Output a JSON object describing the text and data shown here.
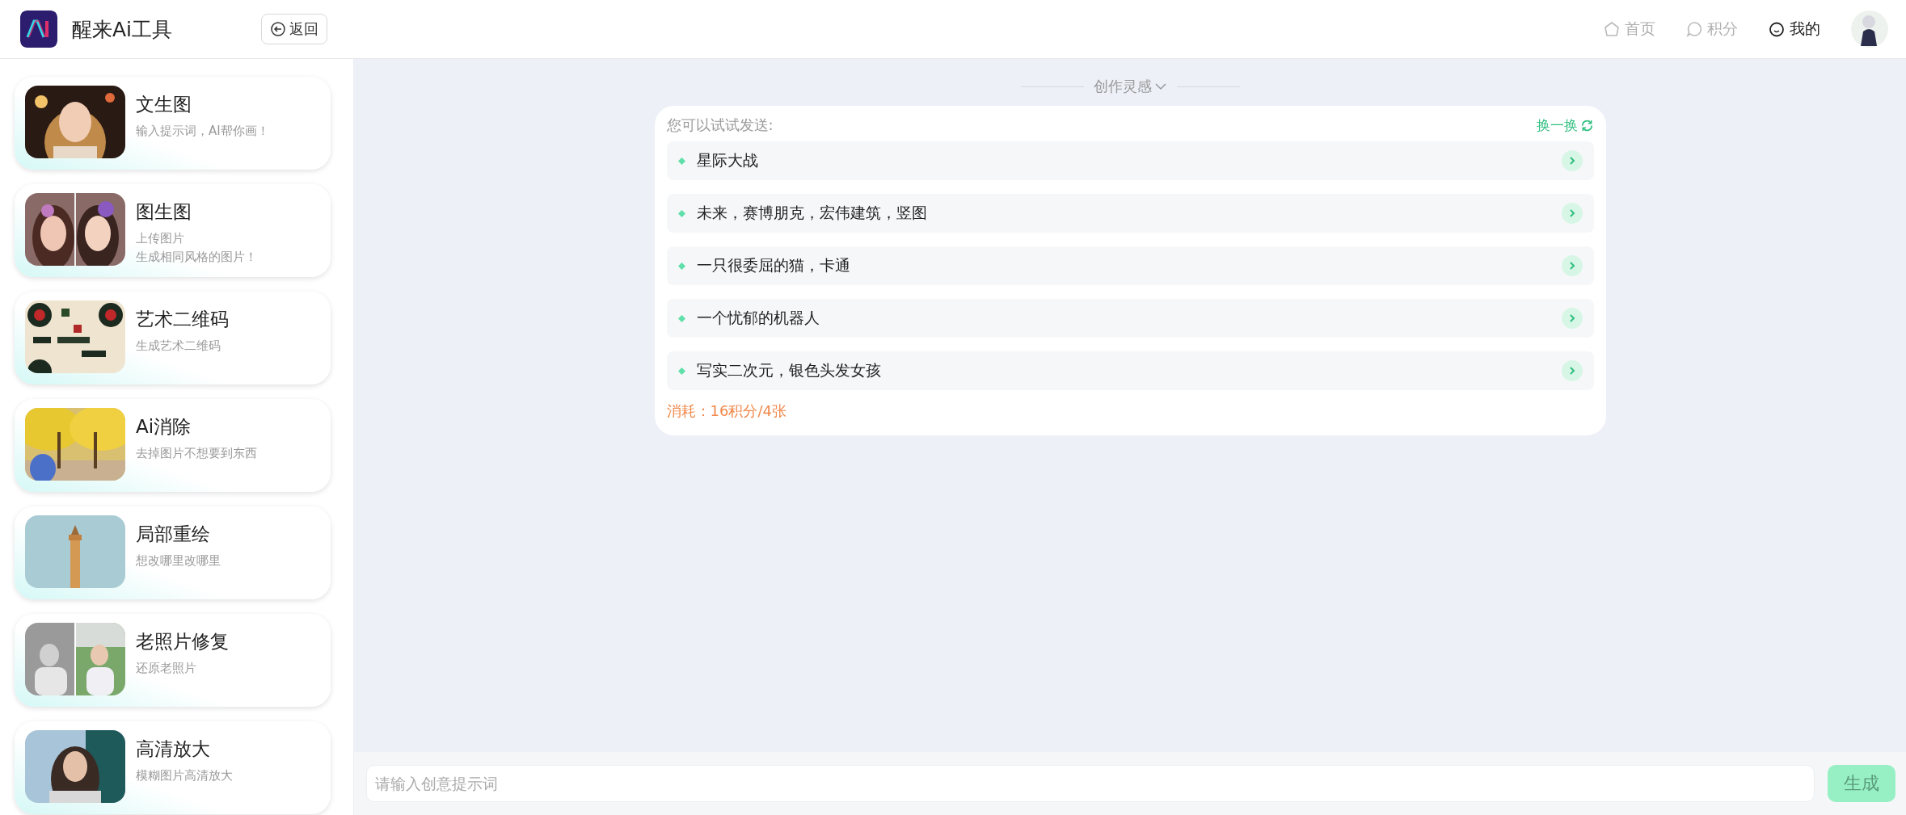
{
  "header": {
    "app_name": "醒来Ai工具",
    "back_button": "返回",
    "nav": [
      {
        "label": "首页",
        "selected": false
      },
      {
        "label": "积分",
        "selected": false
      },
      {
        "label": "我的",
        "selected": true
      }
    ]
  },
  "sidebar": {
    "items": [
      {
        "title": "文生图",
        "subtitle": [
          "输入提示词，AI帮你画！"
        ]
      },
      {
        "title": "图生图",
        "subtitle": [
          "上传图片",
          "生成相同风格的图片！"
        ]
      },
      {
        "title": "艺术二维码",
        "subtitle": [
          "生成艺术二维码"
        ]
      },
      {
        "title": "Ai消除",
        "subtitle": [
          "去掉图片不想要到东西"
        ]
      },
      {
        "title": "局部重绘",
        "subtitle": [
          "想改哪里改哪里"
        ]
      },
      {
        "title": "老照片修复",
        "subtitle": [
          "还原老照片"
        ]
      },
      {
        "title": "高清放大",
        "subtitle": [
          "模糊图片高清放大"
        ]
      }
    ]
  },
  "inspiration": {
    "heading": "创作灵感",
    "prompt_label": "您可以试试发送:",
    "refresh": "换一换",
    "suggestions": [
      "星际大战",
      "未来，赛博朋克，宏伟建筑，竖图",
      "一只很委屈的猫，卡通",
      "一个忧郁的机器人",
      "写实二次元，银色头发女孩"
    ],
    "cost": "消耗：16积分/4张"
  },
  "composer": {
    "placeholder": "请输入创意提示词",
    "submit": "生成"
  }
}
